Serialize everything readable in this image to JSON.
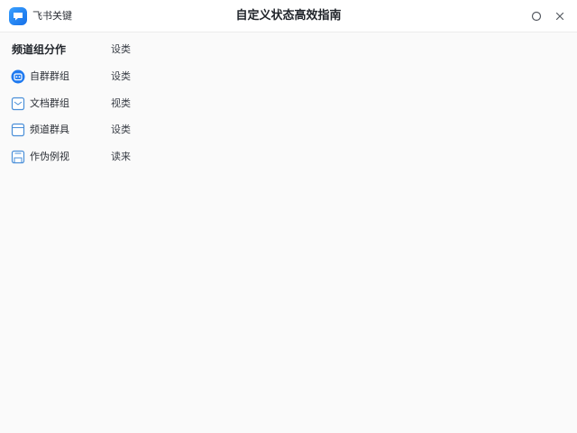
{
  "titlebar": {
    "app_name": "飞书关键",
    "window_title": "自定义状态高效指南"
  },
  "list": {
    "header": {
      "title": "频道组分作",
      "right": "设类"
    },
    "items": [
      {
        "label": "自群群组",
        "right": "设类"
      },
      {
        "label": "文档群组",
        "right": "视类"
      },
      {
        "label": "频道群具",
        "right": "设类"
      },
      {
        "label": "作伪例视",
        "right": "读来"
      }
    ]
  },
  "colors": {
    "accent": "#1f7af0",
    "icon_outline": "#4a8fd8",
    "background": "#fafafa"
  }
}
